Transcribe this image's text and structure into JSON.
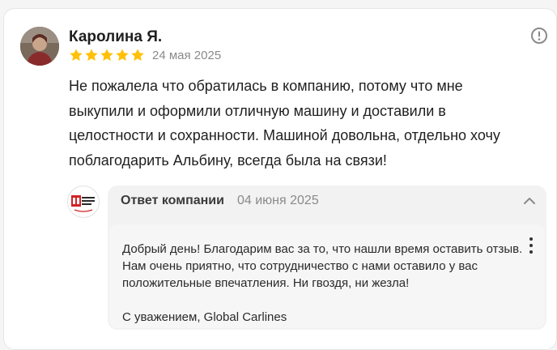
{
  "review": {
    "author": "Каролина Я.",
    "rating": 5,
    "date": "24 мая 2025",
    "text": "Не пожалела что обратилась в компанию, потому что мне выкупили и оформили отличную машину и доставили в целостности и сохранности. Машиной довольна, отдельно хочу поблагодарить Альбину, всегда была на связи!"
  },
  "reply": {
    "title": "Ответ компании",
    "date": "04 июня 2025",
    "text": "Добрый день! Благодарим вас за то, что нашли время оставить отзыв. Нам очень приятно, что сотрудничество с нами оставило у вас положительные впечатления. Ни гвоздя, ни жезла!",
    "signature": "С уважением, Global Carlines"
  },
  "colors": {
    "star": "#ffc107",
    "muted": "#8a8a8a",
    "logo_red": "#d32027"
  },
  "icons": {
    "report": "exclamation-circle-icon",
    "collapse": "chevron-up-icon",
    "more": "kebab-menu-icon"
  }
}
